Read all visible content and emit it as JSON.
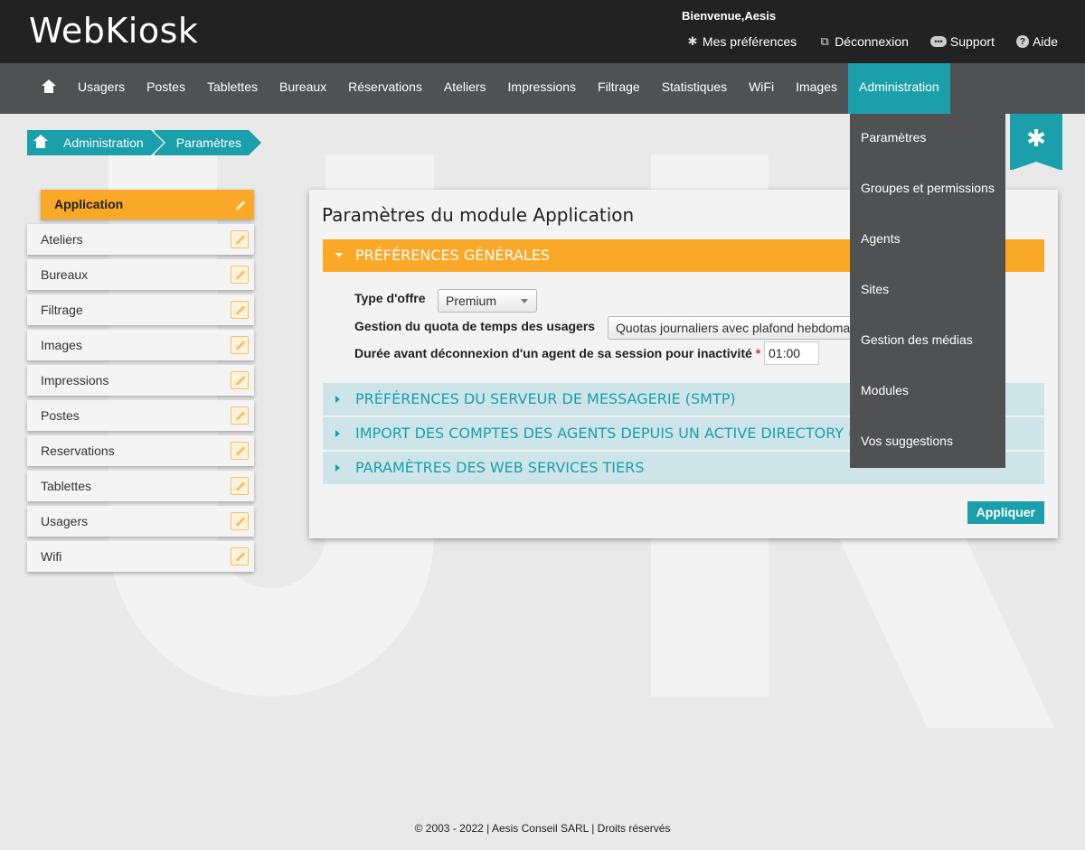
{
  "header": {
    "logo": "WebKiosk",
    "welcome": "Bienvenue,Aesis",
    "links": [
      {
        "label": "Mes préférences",
        "icon": "gear-icon"
      },
      {
        "label": "Déconnexion",
        "icon": "external-link-icon"
      },
      {
        "label": "Support",
        "icon": "chat-bubble-icon"
      },
      {
        "label": "Aide",
        "icon": "help-circle-icon"
      }
    ]
  },
  "nav": {
    "items": [
      "Usagers",
      "Postes",
      "Tablettes",
      "Bureaux",
      "Réservations",
      "Ateliers",
      "Impressions",
      "Filtrage",
      "Statistiques",
      "WiFi",
      "Images",
      "Administration"
    ],
    "active": "Administration"
  },
  "dropdown": {
    "items": [
      "Paramètres",
      "Groupes et permissions",
      "Agents",
      "Sites",
      "Gestion des médias",
      "Modules",
      "Vos suggestions"
    ]
  },
  "breadcrumb": {
    "items": [
      "Administration",
      "Paramètres"
    ]
  },
  "sidebar": {
    "items": [
      "Application",
      "Ateliers",
      "Bureaux",
      "Filtrage",
      "Images",
      "Impressions",
      "Postes",
      "Reservations",
      "Tablettes",
      "Usagers",
      "Wifi"
    ],
    "active": "Application"
  },
  "panel": {
    "title": "Paramètres du module Application",
    "sections": [
      {
        "label": "PRÉFÉRENCES GÉNÉRALES",
        "open": true
      },
      {
        "label": "PRÉFÉRENCES DU SERVEUR DE MESSAGERIE (SMTP)",
        "open": false
      },
      {
        "label": "IMPORT DES COMPTES DES AGENTS DEPUIS UN ACTIVE DIRECTORY (AD)",
        "open": false
      },
      {
        "label": "PARAMÈTRES DES WEB SERVICES TIERS",
        "open": false
      }
    ],
    "fields": {
      "offer_type": {
        "label": "Type d'offre",
        "value": "Premium"
      },
      "quota": {
        "label": "Gestion du quota de temps des usagers",
        "value": "Quotas journaliers avec plafond hebdomadaire"
      },
      "inactivity": {
        "label": "Durée avant déconnexion d'un agent de sa session pour inactivité",
        "required_mark": "*",
        "value": "01:00"
      }
    },
    "apply_label": "Appliquer"
  },
  "footer": {
    "text": "© 2003 - 2022 | Aesis Conseil SARL | Droits réservés"
  }
}
